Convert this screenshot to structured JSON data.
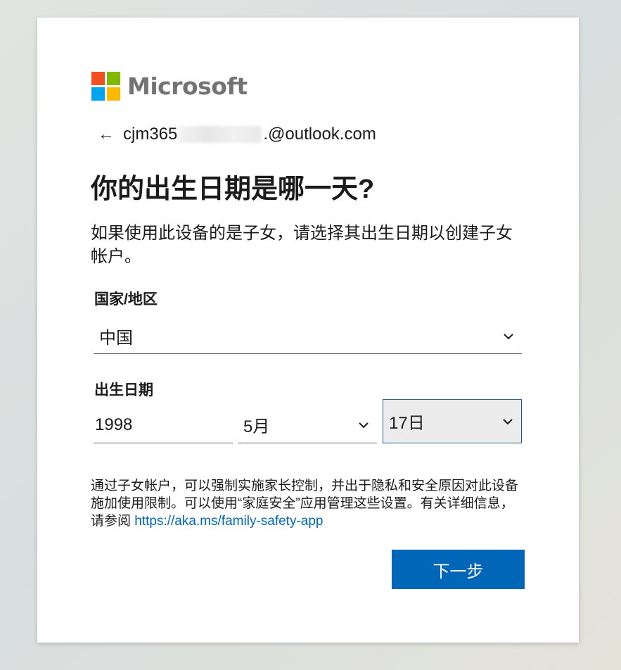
{
  "brand": {
    "name": "Microsoft",
    "colors": [
      "#f25022",
      "#7fba00",
      "#00a4ef",
      "#ffb900"
    ]
  },
  "identity": {
    "back_icon": "back-arrow-icon",
    "email_prefix": "cjm365",
    "email_suffix": ".@outlook.com"
  },
  "title": "你的出生日期是哪一天?",
  "description": "如果使用此设备的是子女，请选择其出生日期以创建子女帐户。",
  "country": {
    "label": "国家/地区",
    "value": "中国"
  },
  "birthdate": {
    "label": "出生日期",
    "year": "1998",
    "month": "5月",
    "day": "17日"
  },
  "info": {
    "text": "通过子女帐户，可以强制实施家长控制，并出于隐私和安全原因对此设备施加使用限制。可以使用“家庭安全”应用管理这些设置。有关详细信息，请参阅 ",
    "link": "https://aka.ms/family-safety-app"
  },
  "next_button": "下一步",
  "accent_color": "#0067b8"
}
